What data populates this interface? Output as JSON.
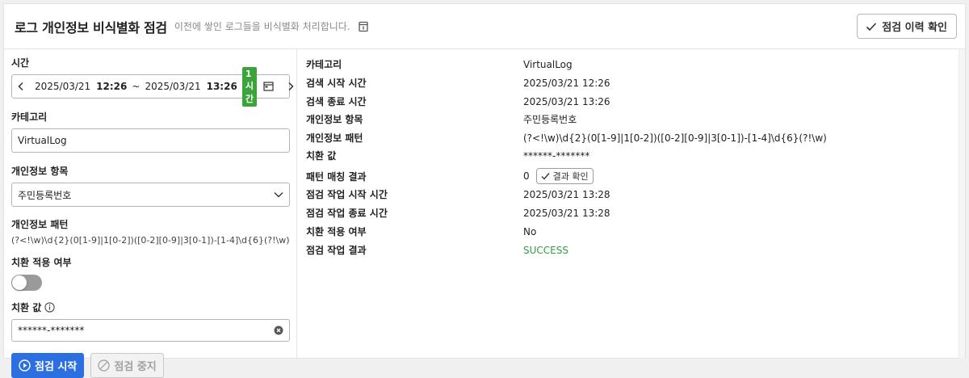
{
  "header": {
    "title": "로그 개인정보 비식별화 점검",
    "subtitle": "이전에 쌓인 로그들을 비식별화 처리합니다.",
    "history_button": "점검 이력 확인",
    "doc_icon": "document-icon",
    "check_icon": "check-icon"
  },
  "form": {
    "time_label": "시간",
    "time": {
      "start_date": "2025/03/21",
      "start_time": "12:26",
      "separator": "~",
      "end_date": "2025/03/21",
      "end_time": "13:26",
      "duration_badge": "1시간"
    },
    "category_label": "카테고리",
    "category_value": "VirtualLog",
    "pii_item_label": "개인정보 항목",
    "pii_item_value": "주민등록번호",
    "pii_pattern_label": "개인정보 패턴",
    "pii_pattern_value": "(?<!\\w)\\d{2}(0[1-9]|1[0-2])([0-2][0-9]|3[0-1])-[1-4]\\d{6}(?!\\w)",
    "apply_label": "치환 적용 여부",
    "apply_enabled": false,
    "replace_label": "치환 값",
    "replace_value": "******-*******",
    "start_button": "점검 시작",
    "stop_button": "점검 중지"
  },
  "details": [
    {
      "label": "카테고리",
      "value": "VirtualLog"
    },
    {
      "label": "검색 시작 시간",
      "value": "2025/03/21 12:26"
    },
    {
      "label": "검색 종료 시간",
      "value": "2025/03/21 13:26"
    },
    {
      "label": "개인정보 항목",
      "value": "주민등록번호"
    },
    {
      "label": "개인정보 패턴",
      "value": "(?<!\\w)\\d{2}(0[1-9]|1[0-2])([0-2][0-9]|3[0-1])-[1-4]\\d{6}(?!\\w)"
    },
    {
      "label": "치환 값",
      "value": "******-*******"
    },
    {
      "label": "패턴 매칭 결과",
      "value": "0",
      "button": "결과 확인"
    },
    {
      "label": "점검 작업 시작 시간",
      "value": "2025/03/21 13:28"
    },
    {
      "label": "점검 작업 종료 시간",
      "value": "2025/03/21 13:28"
    },
    {
      "label": "치환 적용 여부",
      "value": "No"
    },
    {
      "label": "점검 작업 결과",
      "value": "SUCCESS"
    }
  ],
  "colors": {
    "primary": "#2c6fe0",
    "success": "#2ea043",
    "badge": "#3aa43a"
  }
}
